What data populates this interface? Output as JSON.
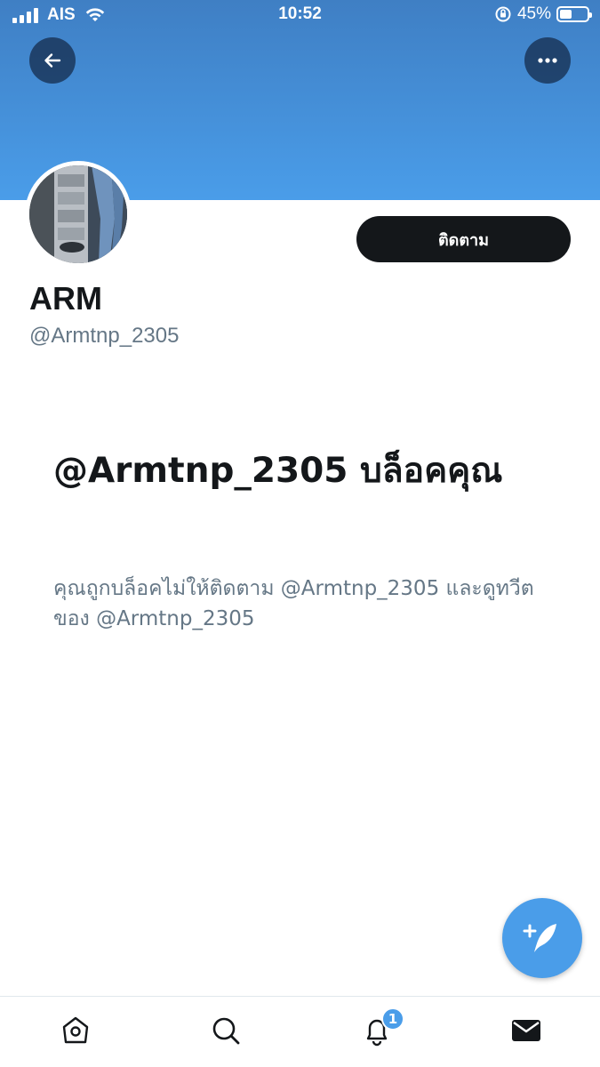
{
  "status_bar": {
    "carrier": "AIS",
    "time": "10:52",
    "battery_percent": "45%",
    "battery_level": 0.45
  },
  "header": {
    "back_icon": "arrow-left-icon",
    "more_icon": "more-horizontal-icon",
    "banner_color": "#4a9de9"
  },
  "profile": {
    "display_name": "ARM",
    "handle": "@Armtnp_2305",
    "follow_label": "ติดตาม"
  },
  "blocked": {
    "title": "@Armtnp_2305 บล็อคคุณ",
    "description": "คุณถูกบล็อคไม่ให้ติดตาม @Armtnp_2305 และดูทวีตของ @Armtnp_2305"
  },
  "fab": {
    "icon": "compose-tweet-icon"
  },
  "tab_bar": {
    "items": [
      "home-icon",
      "search-icon",
      "notifications-icon",
      "messages-icon"
    ],
    "notification_count": "1"
  },
  "colors": {
    "accent": "#4a9de9",
    "text": "#14171a",
    "muted": "#657786"
  }
}
